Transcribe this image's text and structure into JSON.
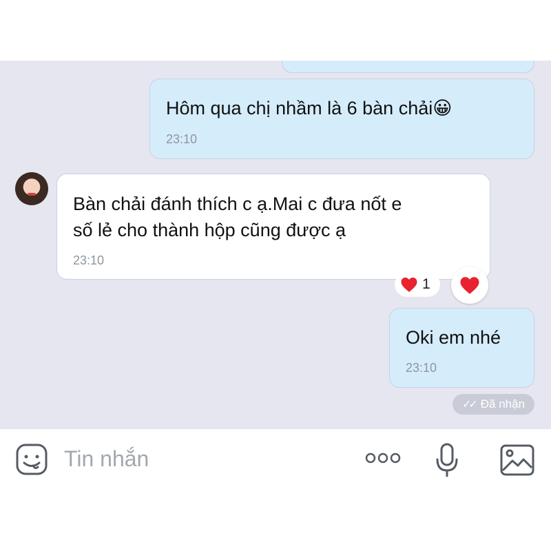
{
  "messages": [
    {
      "direction": "out",
      "text": "Hôm qua chị nhầm là 6 bàn chải😀",
      "time": "23:10"
    },
    {
      "direction": "in",
      "line1": "Bàn chải đánh thích c ạ.Mai c đưa nốt e",
      "line2": "số lẻ cho thành hộp cũng được ạ",
      "time": "23:10",
      "reaction": {
        "icon": "heart-icon",
        "count": "1"
      }
    },
    {
      "direction": "out",
      "text": "Oki em nhé",
      "time": "23:10"
    }
  ],
  "status": {
    "label": "Đã nhận",
    "icon": "double-check-icon"
  },
  "composer": {
    "placeholder": "Tin nhắn"
  },
  "colors": {
    "chat_bg": "#e6e6f0",
    "outgoing_bubble": "#d5ecfb",
    "incoming_bubble": "#ffffff",
    "heart": "#e8222f"
  }
}
